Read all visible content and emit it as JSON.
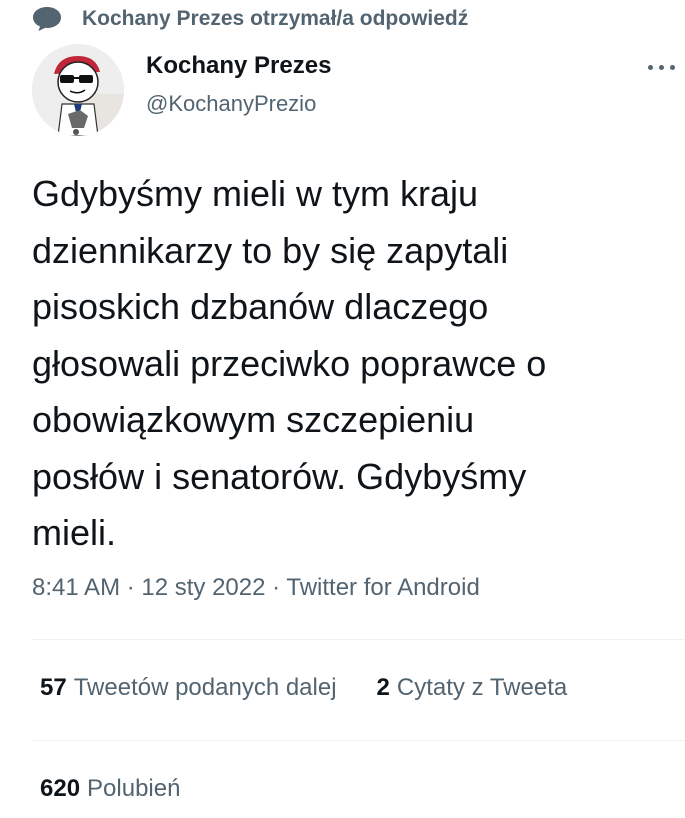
{
  "context": {
    "icon": "speech-bubble-icon",
    "text": "Kochany Prezes otrzymał/a odpowiedź"
  },
  "author": {
    "display_name": "Kochany Prezes",
    "handle": "@KochanyPrezio",
    "avatar_icon": "cartoon-avatar-sunglasses-red-hat"
  },
  "tweet": {
    "text": "Gdybyśmy mieli w tym kraju\ndziennikarzy to by się zapytali\npisoskich dzbanów dlaczego\ngłosowali przeciwko poprawce o\nobowiązkowym szczepieniu\nposłów i senatorów. Gdybyśmy\nmieli.",
    "meta": "8:41 AM · 12 sty 2022 · Twitter for Android"
  },
  "stats": {
    "retweets_count": "57",
    "retweets_label": "Tweetów podanych dalej",
    "quotes_count": "2",
    "quotes_label": "Cytaty z Tweeta",
    "likes_count": "620",
    "likes_label": "Polubień"
  },
  "colors": {
    "secondary_text": "#536471",
    "primary_text": "#0f1419",
    "divider": "#eff3f4"
  }
}
